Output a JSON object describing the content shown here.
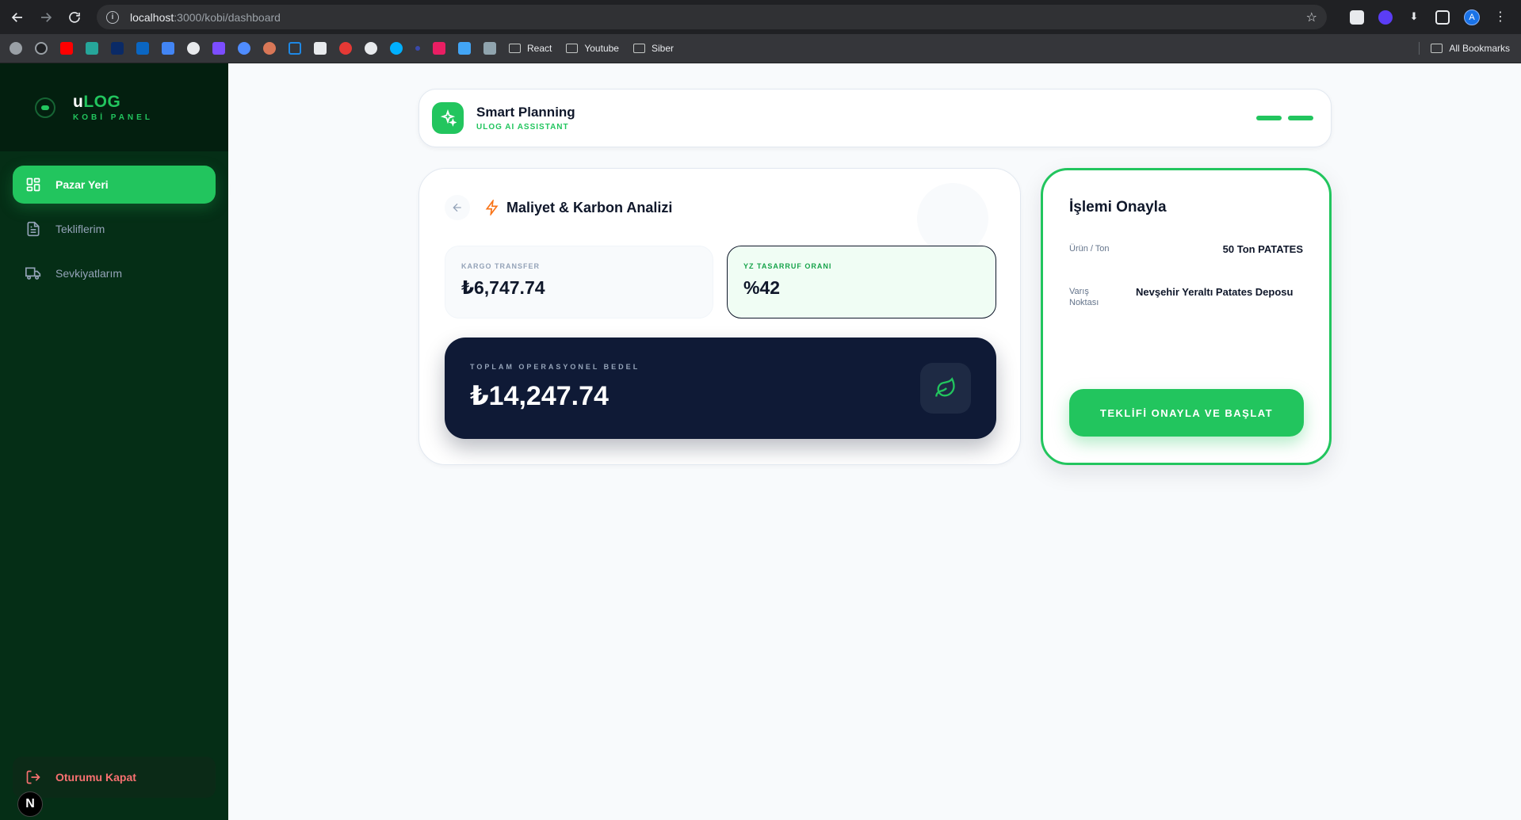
{
  "browser": {
    "url_host": "localhost",
    "url_rest": ":3000/kobi/dashboard",
    "bookmarks": [
      "React",
      "Youtube",
      "Siber"
    ],
    "all_bookmarks": "All Bookmarks",
    "profile_initial": "A"
  },
  "sidebar": {
    "brand_prefix": "u",
    "brand_suffix": "LOG",
    "brand_sub": "KOBİ PANEL",
    "items": [
      {
        "label": "Pazar Yeri"
      },
      {
        "label": "Tekliflerim"
      },
      {
        "label": "Sevkiyatlarım"
      }
    ],
    "logout_label": "Oturumu Kapat",
    "next_badge": "N"
  },
  "header": {
    "title": "Smart Planning",
    "subtitle": "ULOG AI ASSISTANT"
  },
  "analysis": {
    "title": "Maliyet & Karbon Analizi",
    "cargo_label": "KARGO TRANSFER",
    "cargo_value": "₺6,747.74",
    "saving_label": "YZ TASARRUF ORANI",
    "saving_value": "%42",
    "total_label": "TOPLAM OPERASYONEL BEDEL",
    "total_value": "₺14,247.74"
  },
  "confirm": {
    "title": "İşlemi Onayla",
    "product_label": "Ürün / Ton",
    "product_value": "50 Ton PATATES",
    "dest_label": "Varış Noktası",
    "dest_value": "Nevşehir Yeraltı Patates Deposu",
    "button_label": "TEKLİFİ ONAYLA VE BAŞLAT"
  },
  "colors": {
    "brand_green": "#22c55e",
    "sidebar_bg": "#052e16",
    "navy": "#0f1a36",
    "danger": "#f87171"
  }
}
